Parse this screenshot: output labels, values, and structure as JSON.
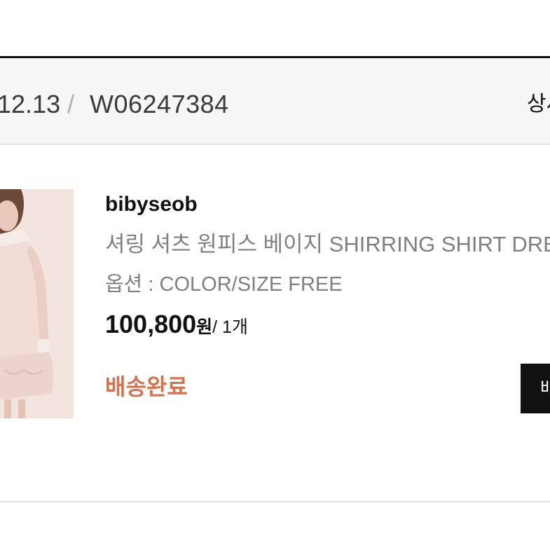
{
  "order": {
    "date": "12.13",
    "separator": "/",
    "number": "W06247384",
    "detail_link": "상세"
  },
  "item": {
    "brand": "bibyseob",
    "product_name": "셔링 셔츠 원피스 베이지 SHIRRING SHIRT DRESS",
    "option": "옵션 : COLOR/SIZE FREE",
    "price": "100,800",
    "price_unit": "원",
    "quantity": "/ 1개",
    "status": "배송완료",
    "status_color": "#d4744f",
    "action_label": "배송조회"
  }
}
